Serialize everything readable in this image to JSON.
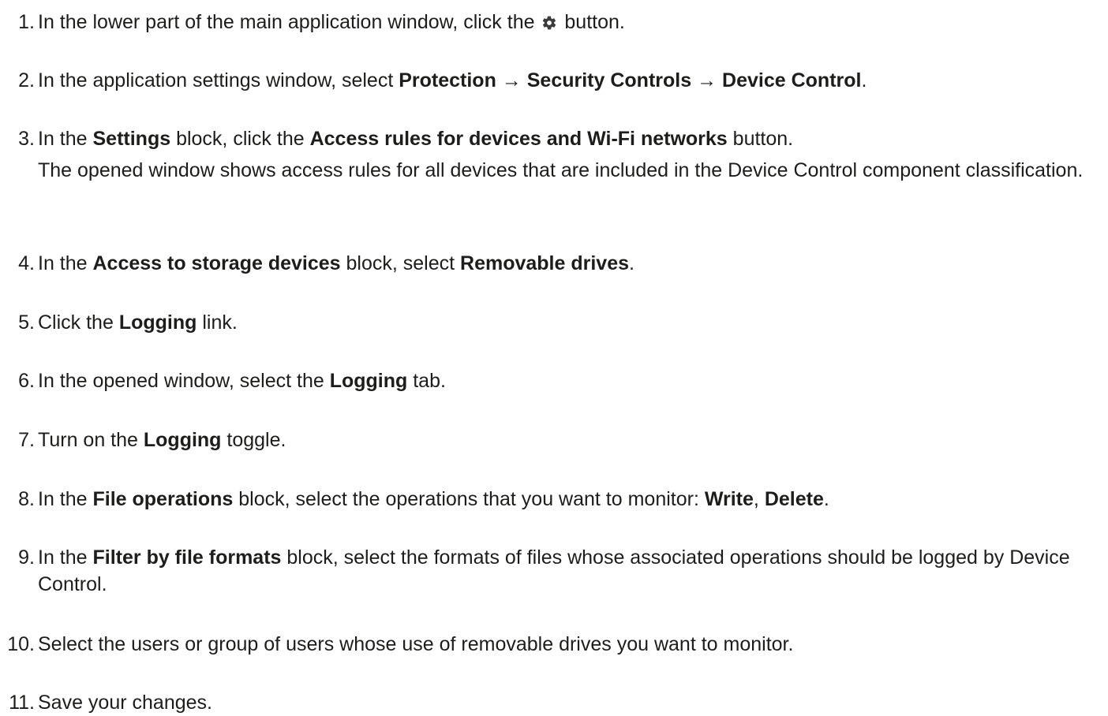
{
  "steps": [
    {
      "number": "1.",
      "pre": "In the lower part of the main application window, click the ",
      "icon": "gear-icon",
      "post": " button."
    },
    {
      "number": "2.",
      "pre": "In the application settings window, select ",
      "b1": "Protection",
      "arrow1": " → ",
      "b2": "Security Controls",
      "arrow2": " → ",
      "b3": "Device Control",
      "post": "."
    },
    {
      "number": "3.",
      "pre": "In the ",
      "b1": "Settings",
      "mid": " block, click the ",
      "b2": "Access rules for devices and Wi-Fi networks",
      "post": " button.",
      "note": "The opened window shows access rules for all devices that are included in the Device Control component classification."
    },
    {
      "number": "4.",
      "pre": "In the ",
      "b1": "Access to storage devices",
      "mid": " block, select ",
      "b2": "Removable drives",
      "post": "."
    },
    {
      "number": "5.",
      "pre": "Click the ",
      "b1": "Logging",
      "post": " link."
    },
    {
      "number": "6.",
      "pre": "In the opened window, select the ",
      "b1": "Logging",
      "post": " tab."
    },
    {
      "number": "7.",
      "pre": "Turn on the ",
      "b1": "Logging",
      "post": " toggle."
    },
    {
      "number": "8.",
      "pre": "In the ",
      "b1": "File operations",
      "mid": " block, select the operations that you want to monitor: ",
      "b2": "Write",
      "sep": ", ",
      "b3": "Delete",
      "post": "."
    },
    {
      "number": "9.",
      "pre": "In the ",
      "b1": "Filter by file formats",
      "post": " block, select the formats of files whose associated operations should be logged by Device Control."
    },
    {
      "number": "10.",
      "text": "Select the users or group of users whose use of removable drives you want to monitor."
    },
    {
      "number": "11.",
      "text": "Save your changes."
    }
  ],
  "colors": {
    "text": "#1d1d1b",
    "icon": "#3c3c3c",
    "background": "#ffffff"
  }
}
